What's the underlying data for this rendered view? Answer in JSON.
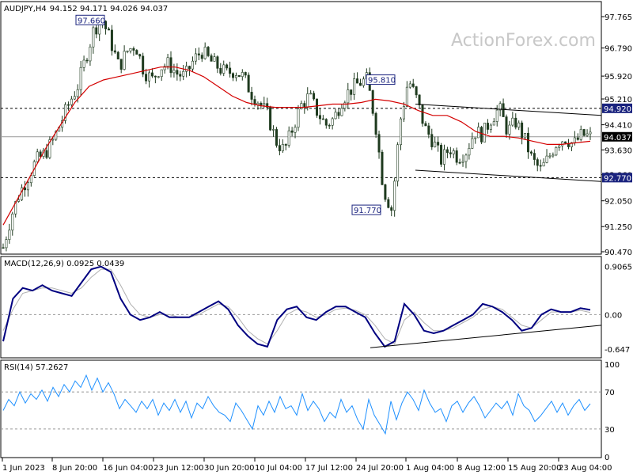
{
  "chart_data": [
    {
      "type": "candlestick",
      "title": "AUDJPY,H4",
      "ohlc": "94.152 94.171 94.026 94.037",
      "price_ticks": [
        "97.765",
        "96.790",
        "95.920",
        "95.210",
        "94.410",
        "93.630",
        "92.860",
        "92.050",
        "91.250",
        "90.470"
      ],
      "ylim": [
        90.47,
        97.765
      ],
      "levels": [
        {
          "label": "94.920",
          "value": 94.92,
          "style": "dashed"
        },
        {
          "label": "92.770",
          "value": 92.77,
          "style": "dashed"
        },
        {
          "label": "94.037",
          "value": 94.037,
          "style": "current"
        }
      ],
      "annotations": [
        {
          "label": "97.660",
          "value": 97.66
        },
        {
          "label": "95.810",
          "value": 95.81
        },
        {
          "label": "91.770",
          "value": 91.77
        }
      ],
      "close_path": [
        90.6,
        91.6,
        92.3,
        92.8,
        93.3,
        93.5,
        93.9,
        94.5,
        95.1,
        95.6,
        96.5,
        97.4,
        97.66,
        97.0,
        96.2,
        96.7,
        96.9,
        96.1,
        95.8,
        96.2,
        96.3,
        96.0,
        95.9,
        96.4,
        96.7,
        96.4,
        96.2,
        96.0,
        96.1,
        95.9,
        95.4,
        95.1,
        94.7,
        93.9,
        93.6,
        94.3,
        95.0,
        95.3,
        94.8,
        94.4,
        94.6,
        95.2,
        95.5,
        95.7,
        95.81,
        94.5,
        92.4,
        91.77,
        94.5,
        95.81,
        95.2,
        94.3,
        93.9,
        93.3,
        93.7,
        93.4,
        93.6,
        94.2,
        94.1,
        94.6,
        94.92,
        94.2,
        94.5,
        94.0,
        93.3,
        93.0,
        93.4,
        93.9,
        94.0,
        93.8,
        94.1,
        94.037
      ],
      "moving_average": [
        91.3,
        92.1,
        92.9,
        93.7,
        94.4,
        95.1,
        95.6,
        95.8,
        95.9,
        96.0,
        96.1,
        96.2,
        96.2,
        96.1,
        95.9,
        95.6,
        95.3,
        95.1,
        95.0,
        94.95,
        94.95,
        94.95,
        95.0,
        95.05,
        95.05,
        95.1,
        95.2,
        95.15,
        95.05,
        94.85,
        94.7,
        94.7,
        94.5,
        94.2,
        94.05,
        94.05,
        94.0,
        93.9,
        93.8,
        93.8,
        93.85,
        93.9
      ],
      "channel": [
        {
          "start": 95.05,
          "end": 94.7
        },
        {
          "start": 93.0,
          "end": 92.65
        }
      ],
      "x_ticks": [
        "1 Jun 2023",
        "8 Jun 20:00",
        "16 Jun 04:00",
        "23 Jun 12:00",
        "30 Jun 20:00",
        "10 Jul 04:00",
        "17 Jul 12:00",
        "24 Jul 20:00",
        "1 Aug 04:00",
        "8 Aug 12:00",
        "15 Aug 20:00",
        "23 Aug 04:00"
      ],
      "watermark": "ActionForex.com",
      "colors": {
        "candle": "#1e3a1e",
        "ma": "#d40000",
        "label_box": "#1a237e",
        "current_label": "#000000"
      }
    },
    {
      "type": "line",
      "title": "MACD(12,26,9) 0.0925 0.0439",
      "ticks": [
        "0.9065",
        "0.00",
        "-0.647"
      ],
      "ylim": [
        -0.75,
        1.0
      ],
      "macd": [
        -0.5,
        0.3,
        0.5,
        0.45,
        0.55,
        0.45,
        0.4,
        0.35,
        0.6,
        0.85,
        0.9,
        0.8,
        0.3,
        0.0,
        -0.1,
        -0.05,
        0.05,
        -0.05,
        -0.05,
        -0.05,
        0.05,
        0.15,
        0.25,
        0.1,
        -0.2,
        -0.4,
        -0.55,
        -0.6,
        -0.1,
        0.1,
        0.15,
        -0.05,
        -0.1,
        0.05,
        0.15,
        0.15,
        0.05,
        -0.05,
        -0.35,
        -0.6,
        -0.5,
        0.2,
        0.0,
        -0.3,
        -0.35,
        -0.3,
        -0.2,
        -0.1,
        0.0,
        0.2,
        0.15,
        0.05,
        -0.1,
        -0.3,
        -0.25,
        0.0,
        0.1,
        0.05,
        0.05,
        0.12,
        0.09
      ],
      "signal": [
        -0.3,
        0.1,
        0.4,
        0.45,
        0.5,
        0.5,
        0.45,
        0.4,
        0.5,
        0.7,
        0.85,
        0.85,
        0.55,
        0.2,
        0.0,
        -0.05,
        0.0,
        0.0,
        -0.05,
        -0.05,
        0.0,
        0.1,
        0.2,
        0.15,
        -0.05,
        -0.3,
        -0.45,
        -0.55,
        -0.3,
        0.0,
        0.1,
        0.05,
        -0.05,
        0.0,
        0.1,
        0.12,
        0.08,
        0.0,
        -0.2,
        -0.45,
        -0.55,
        -0.1,
        0.05,
        -0.15,
        -0.3,
        -0.3,
        -0.25,
        -0.15,
        -0.05,
        0.1,
        0.15,
        0.1,
        -0.05,
        -0.2,
        -0.25,
        -0.1,
        0.05,
        0.05,
        0.05,
        0.08,
        0.04
      ],
      "trendline": {
        "start": -0.62,
        "end": -0.2
      },
      "colors": {
        "macd": "#000080",
        "signal": "#b0b0b0",
        "trendline": "#000000"
      }
    },
    {
      "type": "line",
      "title": "RSI(14) 57.2627",
      "ticks": [
        "100",
        "70",
        "30",
        "0"
      ],
      "ylim": [
        0,
        100
      ],
      "levels": [
        70,
        30
      ],
      "values": [
        50,
        62,
        55,
        70,
        58,
        68,
        62,
        72,
        60,
        75,
        65,
        78,
        70,
        82,
        75,
        88,
        72,
        85,
        70,
        80,
        68,
        52,
        62,
        55,
        48,
        60,
        52,
        62,
        45,
        58,
        50,
        62,
        48,
        60,
        42,
        58,
        52,
        65,
        55,
        48,
        45,
        38,
        58,
        50,
        40,
        30,
        55,
        45,
        60,
        48,
        65,
        52,
        55,
        45,
        68,
        50,
        60,
        52,
        38,
        48,
        42,
        62,
        48,
        55,
        40,
        30,
        62,
        45,
        35,
        25,
        60,
        40,
        58,
        70,
        62,
        50,
        72,
        58,
        48,
        52,
        38,
        55,
        60,
        48,
        58,
        65,
        55,
        42,
        50,
        58,
        52,
        60,
        45,
        68,
        55,
        50,
        38,
        44,
        52,
        60,
        48,
        58,
        45,
        55,
        62,
        50,
        57.26
      ],
      "colors": {
        "line": "#1e90ff"
      }
    }
  ]
}
